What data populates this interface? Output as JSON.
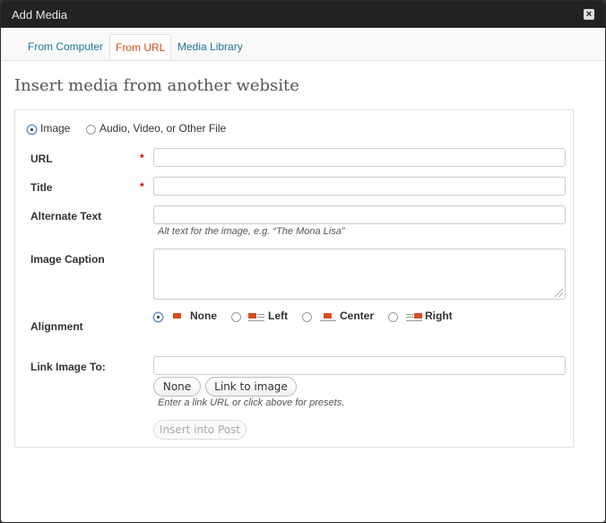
{
  "window": {
    "title": "Add Media"
  },
  "tabs": [
    {
      "label": "From Computer"
    },
    {
      "label": "From URL"
    },
    {
      "label": "Media Library"
    }
  ],
  "heading": "Insert media from another website",
  "media_type": {
    "options": [
      "Image",
      "Audio, Video, or Other File"
    ],
    "selected": "Image"
  },
  "fields": {
    "url_label": "URL",
    "title_label": "Title",
    "alt_label": "Alternate Text",
    "alt_hint": "Alt text for the image, e.g. “The Mona Lisa”",
    "caption_label": "Image Caption",
    "alignment_label": "Alignment",
    "link_label": "Link Image To:",
    "link_hint": "Enter a link URL or click above for presets.",
    "required_mark": "*"
  },
  "alignment": {
    "options": [
      "None",
      "Left",
      "Center",
      "Right"
    ],
    "selected": "None"
  },
  "buttons": {
    "link_none": "None",
    "link_to_image": "Link to image",
    "insert": "Insert into Post"
  },
  "colors": {
    "accent": "#d54e21",
    "link": "#21759b"
  }
}
